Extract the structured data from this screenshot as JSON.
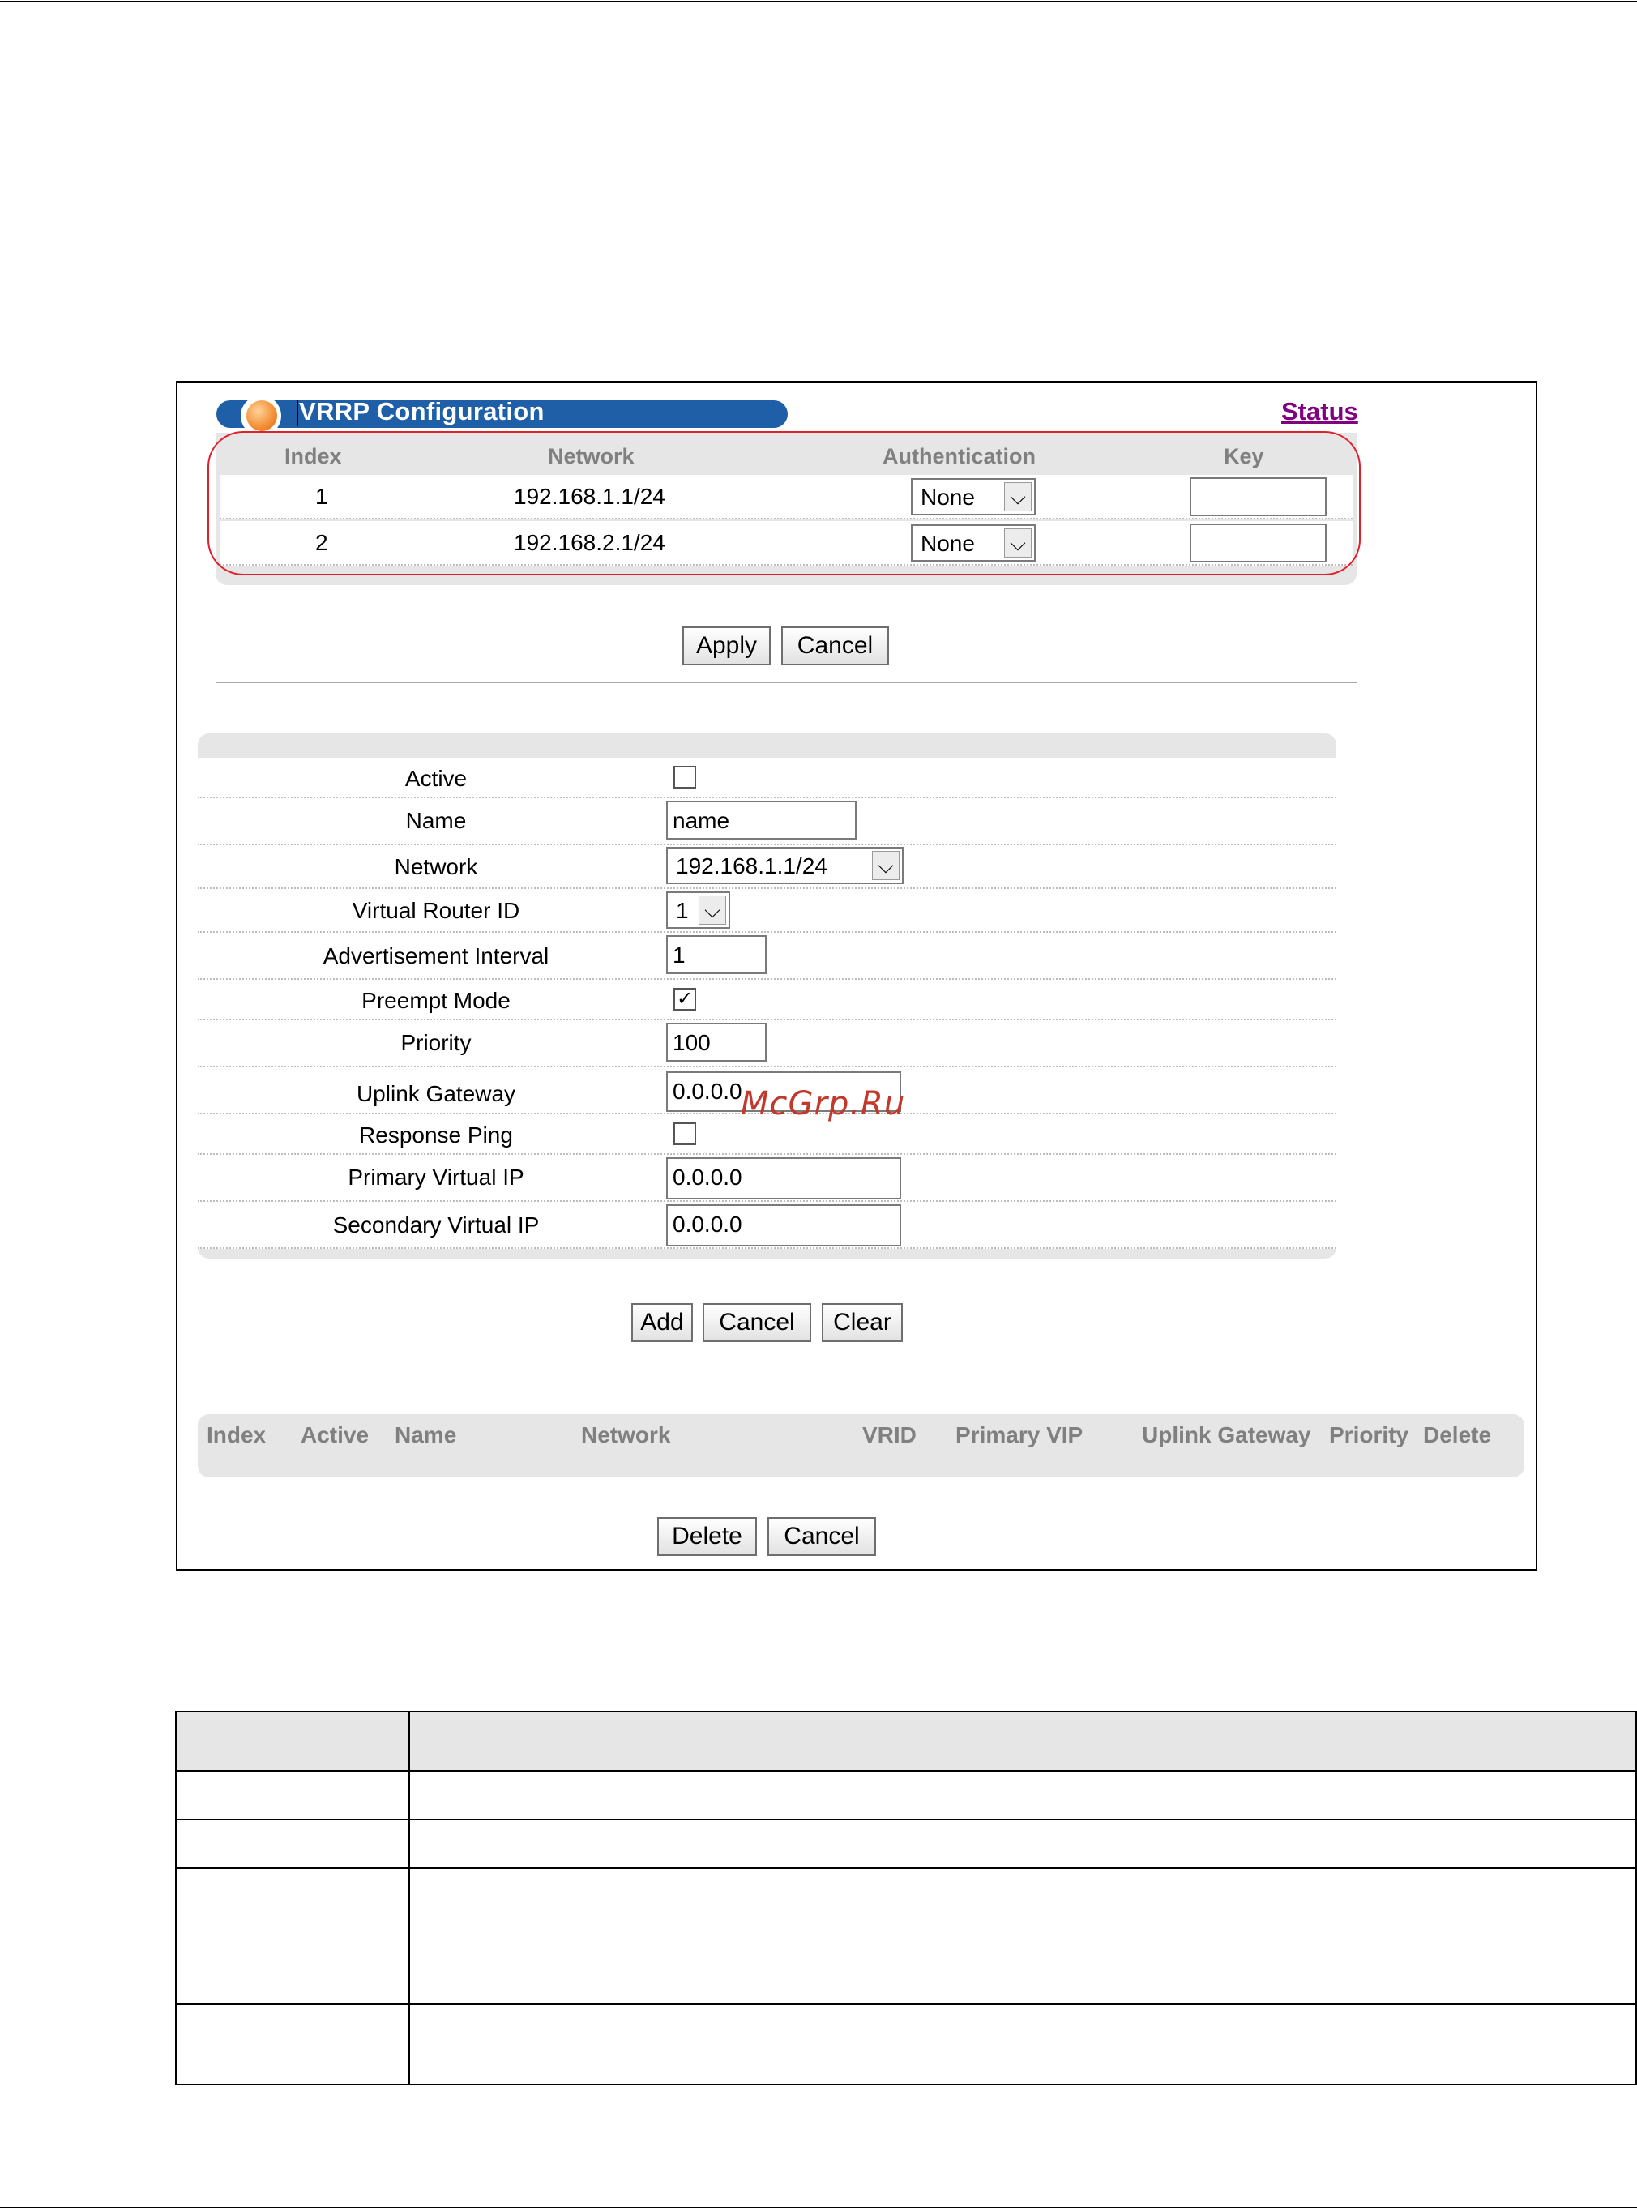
{
  "vrrp_table": {
    "title": "VRRP Configuration",
    "status_link": "Status",
    "headers": [
      "Index",
      "Network",
      "Authentication",
      "Key"
    ],
    "rows": [
      {
        "index": "1",
        "network": "192.168.1.1/24",
        "authentication": "None",
        "key": ""
      },
      {
        "index": "2",
        "network": "192.168.2.1/24",
        "authentication": "None",
        "key": ""
      }
    ],
    "apply_label": "Apply",
    "cancel_label": "Cancel"
  },
  "form": {
    "active": {
      "label": "Active",
      "checked": false
    },
    "name": {
      "label": "Name",
      "value": "name"
    },
    "network": {
      "label": "Network",
      "value": "192.168.1.1/24"
    },
    "virtual_router_id": {
      "label": "Virtual Router ID",
      "value": "1"
    },
    "advertisement_interval": {
      "label": "Advertisement Interval",
      "value": "1"
    },
    "preempt_mode": {
      "label": "Preempt Mode",
      "checked": true
    },
    "priority": {
      "label": "Priority",
      "value": "100"
    },
    "uplink_gateway": {
      "label": "Uplink Gateway",
      "value": "0.0.0.0"
    },
    "response_ping": {
      "label": "Response Ping",
      "checked": false
    },
    "primary_virtual_ip": {
      "label": "Primary Virtual IP",
      "value": "0.0.0.0"
    },
    "secondary_virtual_ip": {
      "label": "Secondary Virtual IP",
      "value": "0.0.0.0"
    },
    "add_label": "Add",
    "cancel_label": "Cancel",
    "clear_label": "Clear"
  },
  "summary_table": {
    "headers": [
      "Index",
      "Active",
      "Name",
      "Network",
      "VRID",
      "Primary VIP",
      "Uplink Gateway",
      "Priority",
      "Delete"
    ],
    "delete_label": "Delete",
    "cancel_label": "Cancel"
  },
  "watermark": "McGrp.Ru",
  "icons": {
    "dropdown": "chevron-down-icon",
    "check": "check-icon",
    "orb": "orb-icon"
  }
}
